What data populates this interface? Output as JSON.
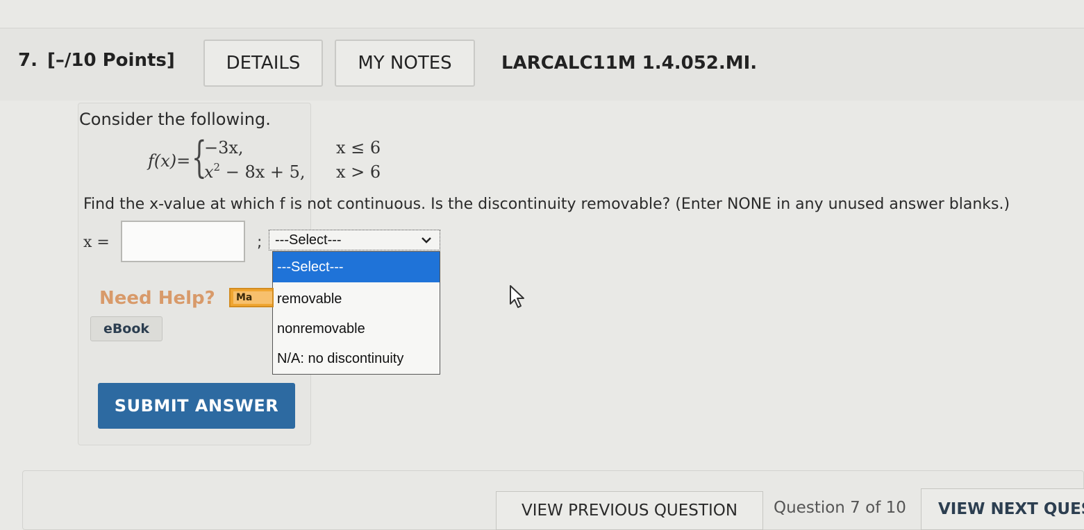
{
  "header": {
    "question_number": "7.",
    "points": "[–/10 Points]",
    "details_label": "DETAILS",
    "my_notes_label": "MY NOTES",
    "problem_code": "LARCALC11M 1.4.052.MI."
  },
  "question": {
    "intro": "Consider the following.",
    "function_lhs": "f(x)=",
    "pieces": [
      {
        "expr_text": "−3x,",
        "condition": "x ≤ 6"
      },
      {
        "expr_base": "x",
        "expr_exp": "2",
        "expr_rest": " − 8x + 5,",
        "condition": "x > 6"
      }
    ],
    "instruction": "Find the x-value at which f is not continuous. Is the discontinuity removable? (Enter NONE in any unused answer blanks.)",
    "x_label": "x =",
    "x_value": "",
    "separator": ";"
  },
  "select": {
    "current": "---Select---",
    "options": [
      "---Select---",
      "removable",
      "nonremovable",
      "N/A: no discontinuity"
    ],
    "highlighted_index": 0
  },
  "help": {
    "need_help_label": "Need Help?",
    "master_it_label": "Ma",
    "ebook_label": "eBook"
  },
  "submit_label": "SUBMIT ANSWER",
  "nav": {
    "prev_label": "VIEW PREVIOUS QUESTION",
    "counter": "Question 7 of 10",
    "next_label": "VIEW NEXT QUEST"
  }
}
